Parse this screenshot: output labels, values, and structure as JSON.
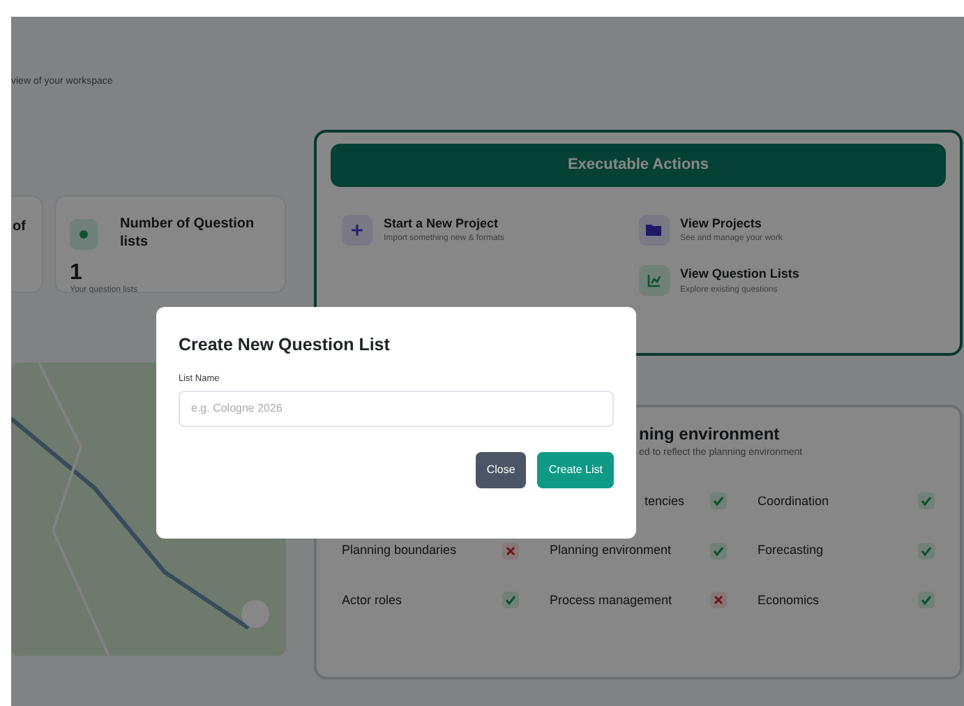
{
  "page": {
    "subtitle": "view of your workspace"
  },
  "stats": [
    {
      "title": "of"
    },
    {
      "title": "Number of Question lists",
      "value": "1",
      "caption": "Your question lists"
    }
  ],
  "actions": {
    "title": "Executable Actions",
    "items": [
      {
        "kind": "plus",
        "title": "Start a New Project",
        "caption": "Import something new & formats"
      },
      {
        "kind": "folder",
        "title": "View Projects",
        "caption": "See and manage your work"
      },
      {
        "kind": "chart",
        "title": "View Question Lists",
        "caption": "Explore existing questions"
      }
    ]
  },
  "environment": {
    "title": "ning environment",
    "subtitle": "ed to reflect the planning environment",
    "items": [
      {
        "label": "tencies",
        "ok": true
      },
      {
        "label": "Coordination",
        "ok": true
      },
      {
        "label": "Planning boundaries",
        "ok": false
      },
      {
        "label": "Planning environment",
        "ok": true
      },
      {
        "label": "Forecasting",
        "ok": true
      },
      {
        "label": "Actor roles",
        "ok": true
      },
      {
        "label": "Process management",
        "ok": false
      },
      {
        "label": "Economics",
        "ok": true
      }
    ]
  },
  "modal": {
    "title": "Create New Question List",
    "field_label": "List Name",
    "placeholder": "e.g. Cologne 2026",
    "buttons": [
      {
        "kind": "secondary",
        "label": "Close"
      },
      {
        "kind": "primary",
        "label": "Create List"
      }
    ]
  }
}
